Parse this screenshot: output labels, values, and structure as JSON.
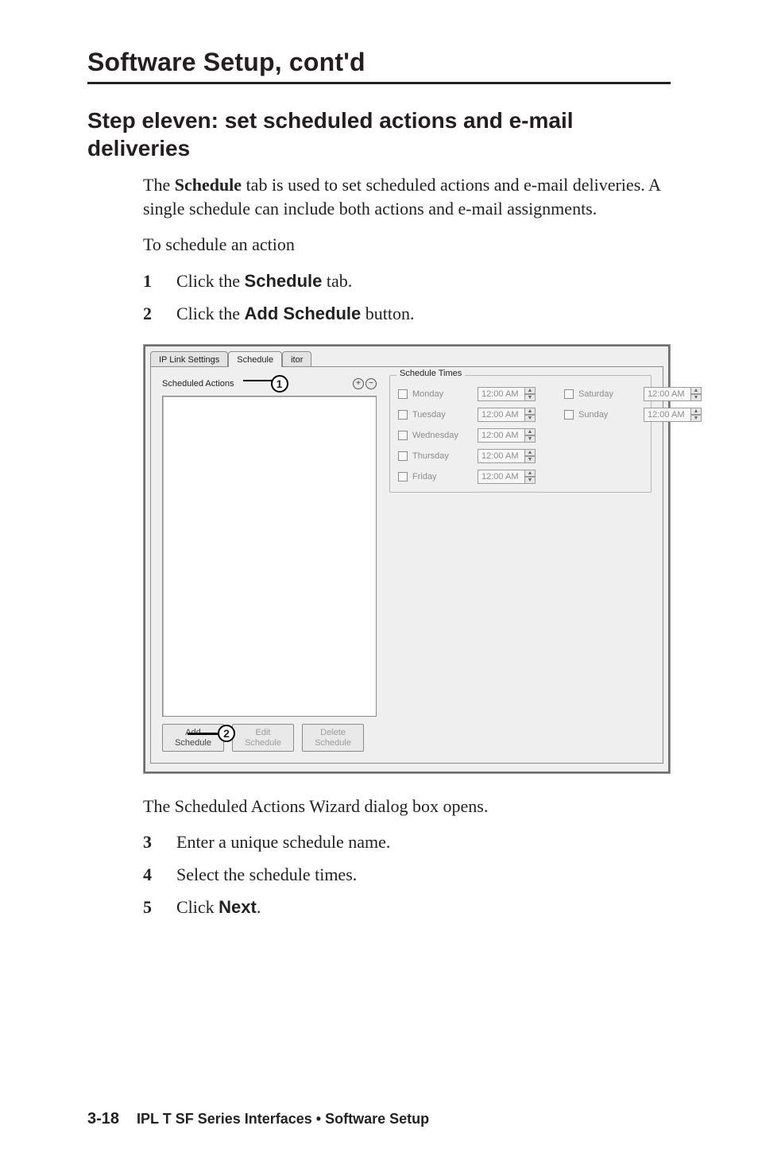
{
  "chapterTitle": "Software Setup, cont'd",
  "sectionTitle": "Step eleven: set scheduled actions and e-mail deliveries",
  "intro": {
    "p1a": "The ",
    "p1b": "Schedule",
    "p1c": " tab is used to set scheduled actions and e-mail deliveries.  A single schedule can include both actions and e-mail assignments.",
    "p2": "To schedule an action"
  },
  "steps1": [
    {
      "n": "1",
      "pre": "Click the ",
      "bold": "Schedule",
      "post": " tab."
    },
    {
      "n": "2",
      "pre": "Click the ",
      "bold": "Add Schedule",
      "post": " button."
    }
  ],
  "dialogCaption": "The Scheduled Actions Wizard dialog box opens.",
  "steps2": [
    {
      "n": "3",
      "pre": "Enter a unique schedule name.",
      "bold": "",
      "post": ""
    },
    {
      "n": "4",
      "pre": "Select the schedule times.",
      "bold": "",
      "post": ""
    },
    {
      "n": "5",
      "pre": "Click ",
      "bold": "Next",
      "post": "."
    }
  ],
  "screenshot": {
    "tabs": {
      "left": "IP Link Settings",
      "active": "Schedule",
      "right": "itor"
    },
    "scheduledActionsLabel": "Scheduled Actions",
    "annot1": "1",
    "plus": "+",
    "minus": "−",
    "annot2": "2",
    "buttons": {
      "add": "Add Schedule",
      "edit": "Edit Schedule",
      "del": "Delete Schedule"
    },
    "timesTitle": "Schedule Times",
    "days": {
      "mon": "Monday",
      "tue": "Tuesday",
      "wed": "Wednesday",
      "thu": "Thursday",
      "fri": "Friday",
      "sat": "Saturday",
      "sun": "Sunday"
    },
    "time": "12:00 AM"
  },
  "footer": {
    "pageno": "3-18",
    "text": "IPL T SF Series Interfaces • Software Setup"
  }
}
